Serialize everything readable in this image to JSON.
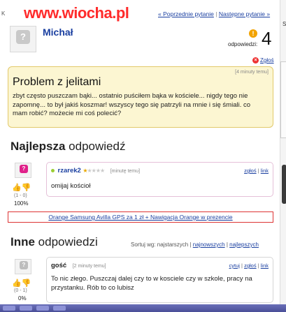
{
  "site": {
    "watermark": "www.wiocha.pl",
    "category": "K"
  },
  "nav": {
    "prev_label": "« Poprzednie pytanie",
    "separator": "|",
    "next_label": "Następne pytanie »"
  },
  "question": {
    "author": "Michał",
    "answers_label": "odpowiedzi:",
    "answers_count": "4",
    "report_label": "Zgłoś",
    "time": "[4 minuty temu]",
    "title": "Problem z jelitami",
    "body": "zbyt często puszczam bąki... ostatnio puściłem bąka w kościele... nigdy tego nie zapomnę... to był jakiś koszmar! wszyscy tego się patrzyli na mnie i się śmiali. co mam robić? możecie mi coś polecić?"
  },
  "best_answer": {
    "heading_bold": "Najlepsza",
    "heading_rest": " odpowiedź",
    "user": "rzarek2",
    "stars": "★★★★★",
    "time": "[minutę temu]",
    "report": "zgłoś",
    "link": "link",
    "text": "omijaj kościoł",
    "votes": "(1 - 0)",
    "percent": "100%"
  },
  "promo": {
    "text": "Orange Samsung Avilla GPS za 1 zł + Nawigacja Orange w prezencie"
  },
  "other_answers": {
    "heading_bold": "Inne",
    "heading_rest": " odpowiedzi",
    "sort_label": "Sortuj wg: najstarszych",
    "sort_newest": "najnowszych",
    "sort_best": "najlepszych",
    "items": [
      {
        "user": "gość",
        "time": "[2 minuty temu]",
        "quote": "cytuj",
        "report": "zgłoś",
        "link": "link",
        "text": "To nic złego. Puszczaj dalej czy to w kosciele czy w szkole, pracy na przystanku. Rób to co lubisz",
        "votes": "(0 - 1)",
        "percent": "0%"
      }
    ]
  },
  "side": {
    "letter": "S"
  },
  "colors": {
    "link": "#1a3fa0",
    "question_bg": "#fcf6d2",
    "promo_border": "#dd3333",
    "watermark": "#ff2b2b",
    "accent_orange": "#f2a300"
  }
}
